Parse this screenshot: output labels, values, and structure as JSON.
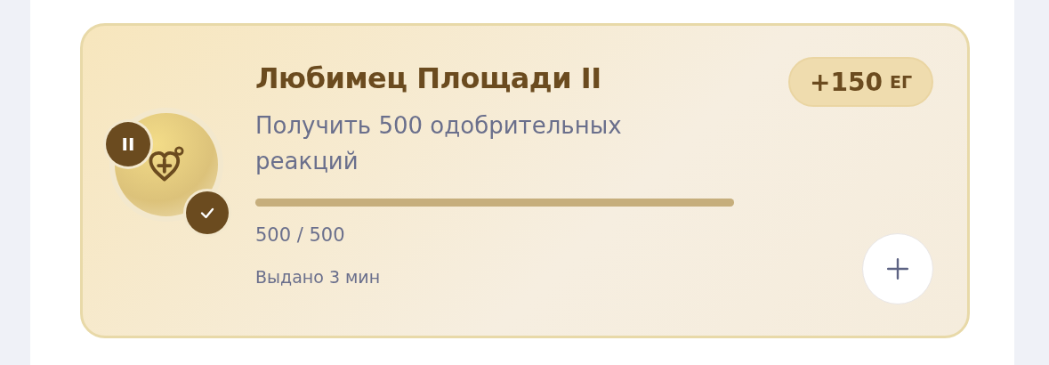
{
  "achievement": {
    "tier": "II",
    "completed": true,
    "title": "Любимец Площади II",
    "description": "Получить 500 одобрительных реакций",
    "level": 1.0,
    "progress": "500 / 500",
    "issued": "Выдано 3 мин",
    "reward": {
      "amount": "+150",
      "unit": "ЕГ"
    }
  }
}
